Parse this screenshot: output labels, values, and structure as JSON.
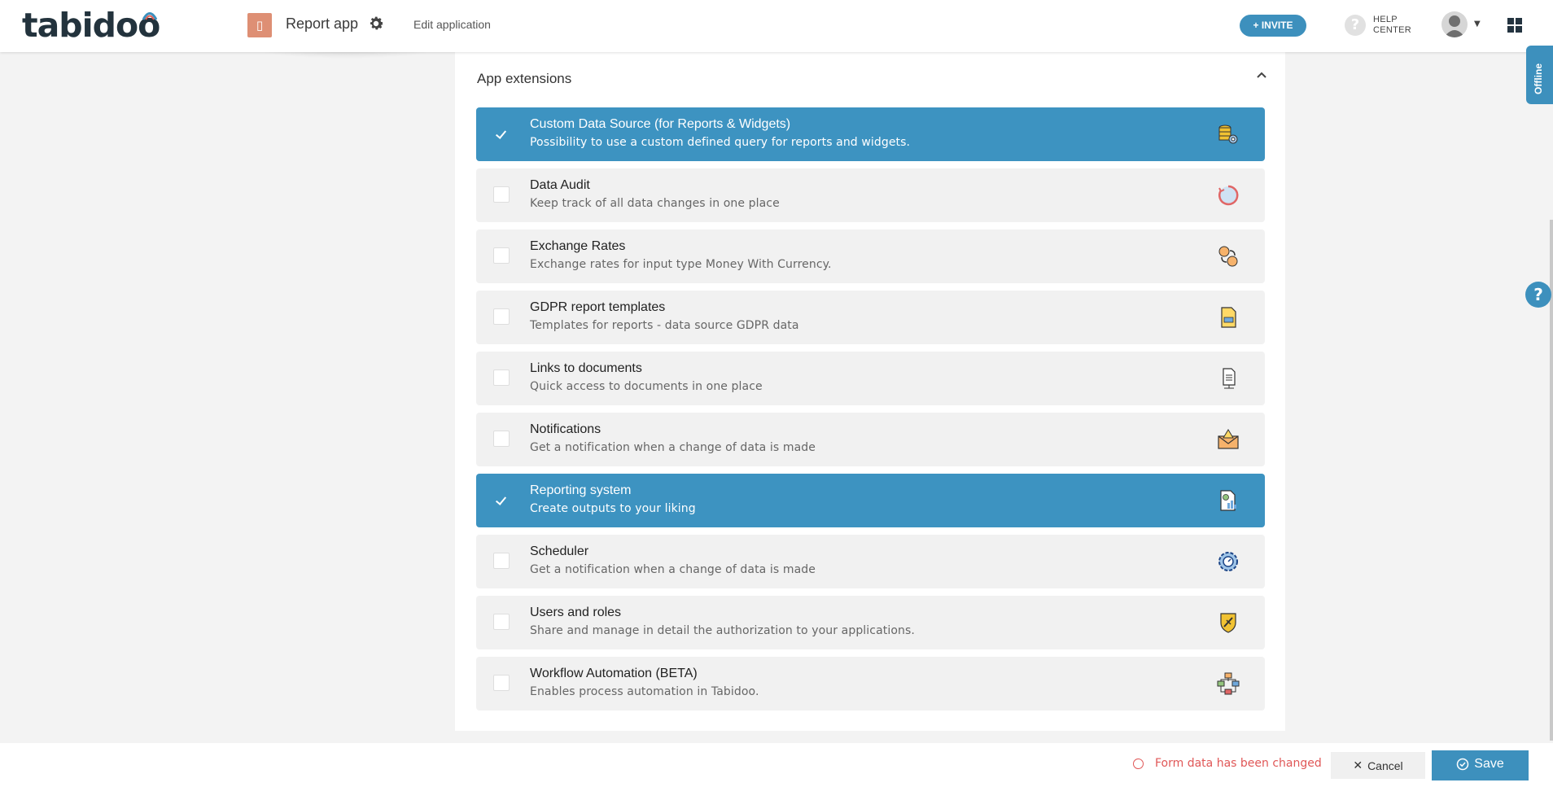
{
  "header": {
    "logo_text": "tabidoo",
    "app_icon_glyph": "▯",
    "app_name": "Report app",
    "edit_link": "Edit application",
    "invite_label": "+ INVITE",
    "help_glyph": "?",
    "help_line1": "HELP",
    "help_line2": "CENTER"
  },
  "side": {
    "offline_label": "Offline",
    "help_glyph": "?"
  },
  "panel": {
    "title": "App extensions",
    "extensions": [
      {
        "title": "Custom Data Source (for Reports & Widgets)",
        "description": "Possibility to use a custom defined query for reports and widgets.",
        "checked": true,
        "icon": "database-gear-icon"
      },
      {
        "title": "Data Audit",
        "description": "Keep track of all data changes in one place",
        "checked": false,
        "icon": "audit-history-icon"
      },
      {
        "title": "Exchange Rates",
        "description": "Exchange rates for input type Money With Currency.",
        "checked": false,
        "icon": "currency-exchange-icon"
      },
      {
        "title": "GDPR report templates",
        "description": "Templates for reports - data source GDPR data",
        "checked": false,
        "icon": "gdpr-document-icon"
      },
      {
        "title": "Links to documents",
        "description": "Quick access to documents in one place",
        "checked": false,
        "icon": "document-link-icon"
      },
      {
        "title": "Notifications",
        "description": "Get a notification when a change of data is made",
        "checked": false,
        "icon": "envelope-alert-icon"
      },
      {
        "title": "Reporting system",
        "description": "Create outputs to your liking",
        "checked": true,
        "icon": "report-chart-icon"
      },
      {
        "title": "Scheduler",
        "description": "Get a notification when a change of data is made",
        "checked": false,
        "icon": "scheduler-gear-icon"
      },
      {
        "title": "Users and roles",
        "description": "Share and manage in detail the authorization to your applications.",
        "checked": false,
        "icon": "shield-key-icon"
      },
      {
        "title": "Workflow Automation (BETA)",
        "description": "Enables process automation in Tabidoo.",
        "checked": false,
        "icon": "workflow-diagram-icon"
      }
    ]
  },
  "footer": {
    "changed_message": "Form data has been changed",
    "cancel_label": "Cancel",
    "save_label": "Save"
  },
  "colors": {
    "accent": "#3d90bd",
    "active_row": "#3d93c1",
    "warning": "#e05757",
    "app_icon": "#de8f74"
  }
}
